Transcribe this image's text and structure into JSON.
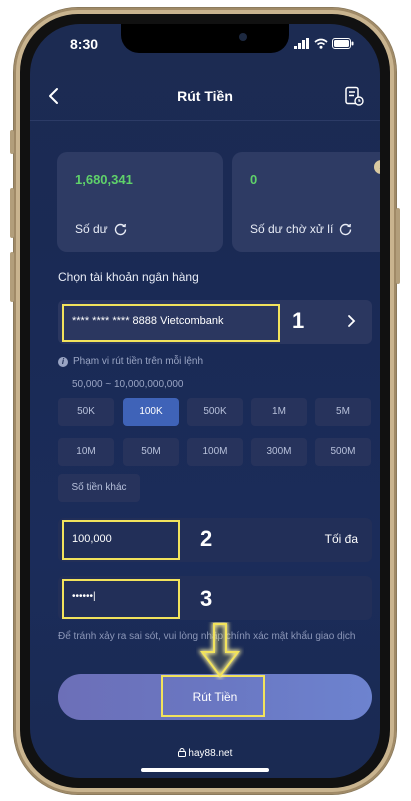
{
  "status": {
    "time": "8:30"
  },
  "header": {
    "title": "Rút Tiền"
  },
  "balance_card": {
    "value": "1,680,341",
    "label": "Số dư",
    "value_color": "#5fd16a"
  },
  "pending_card": {
    "value": "0",
    "label": "Số dư chờ xử lí",
    "value_color": "#5fd16a"
  },
  "bank_section": {
    "label": "Chọn tài khoản ngân hàng",
    "account": "**** **** **** 8888 Vietcombank"
  },
  "limits": {
    "title": "Phạm vi rút tiền trên mỗi lệnh",
    "range": "50,000 ~ 10,000,000,000"
  },
  "amount_chips": [
    "50K",
    "100K",
    "500K",
    "1M",
    "5M",
    "10M",
    "50M",
    "100M",
    "300M",
    "500M"
  ],
  "active_chip": "100K",
  "other_amount_label": "Số tiền khác",
  "amount_field": {
    "value": "100,000",
    "max_label": "Tối đa"
  },
  "password_field": {
    "value": "••••••|"
  },
  "note": "Để tránh xảy ra sai sót, vui lòng nhập chính xác mật khẩu giao dịch",
  "submit": {
    "label": "Rút Tiền"
  },
  "annotations": {
    "one": "1",
    "two": "2",
    "three": "3"
  },
  "footer": {
    "domain": "hay88.net"
  },
  "colors": {
    "highlight": "#f2e35c",
    "accent": "#3f63b8",
    "background": "#1c2b52"
  }
}
